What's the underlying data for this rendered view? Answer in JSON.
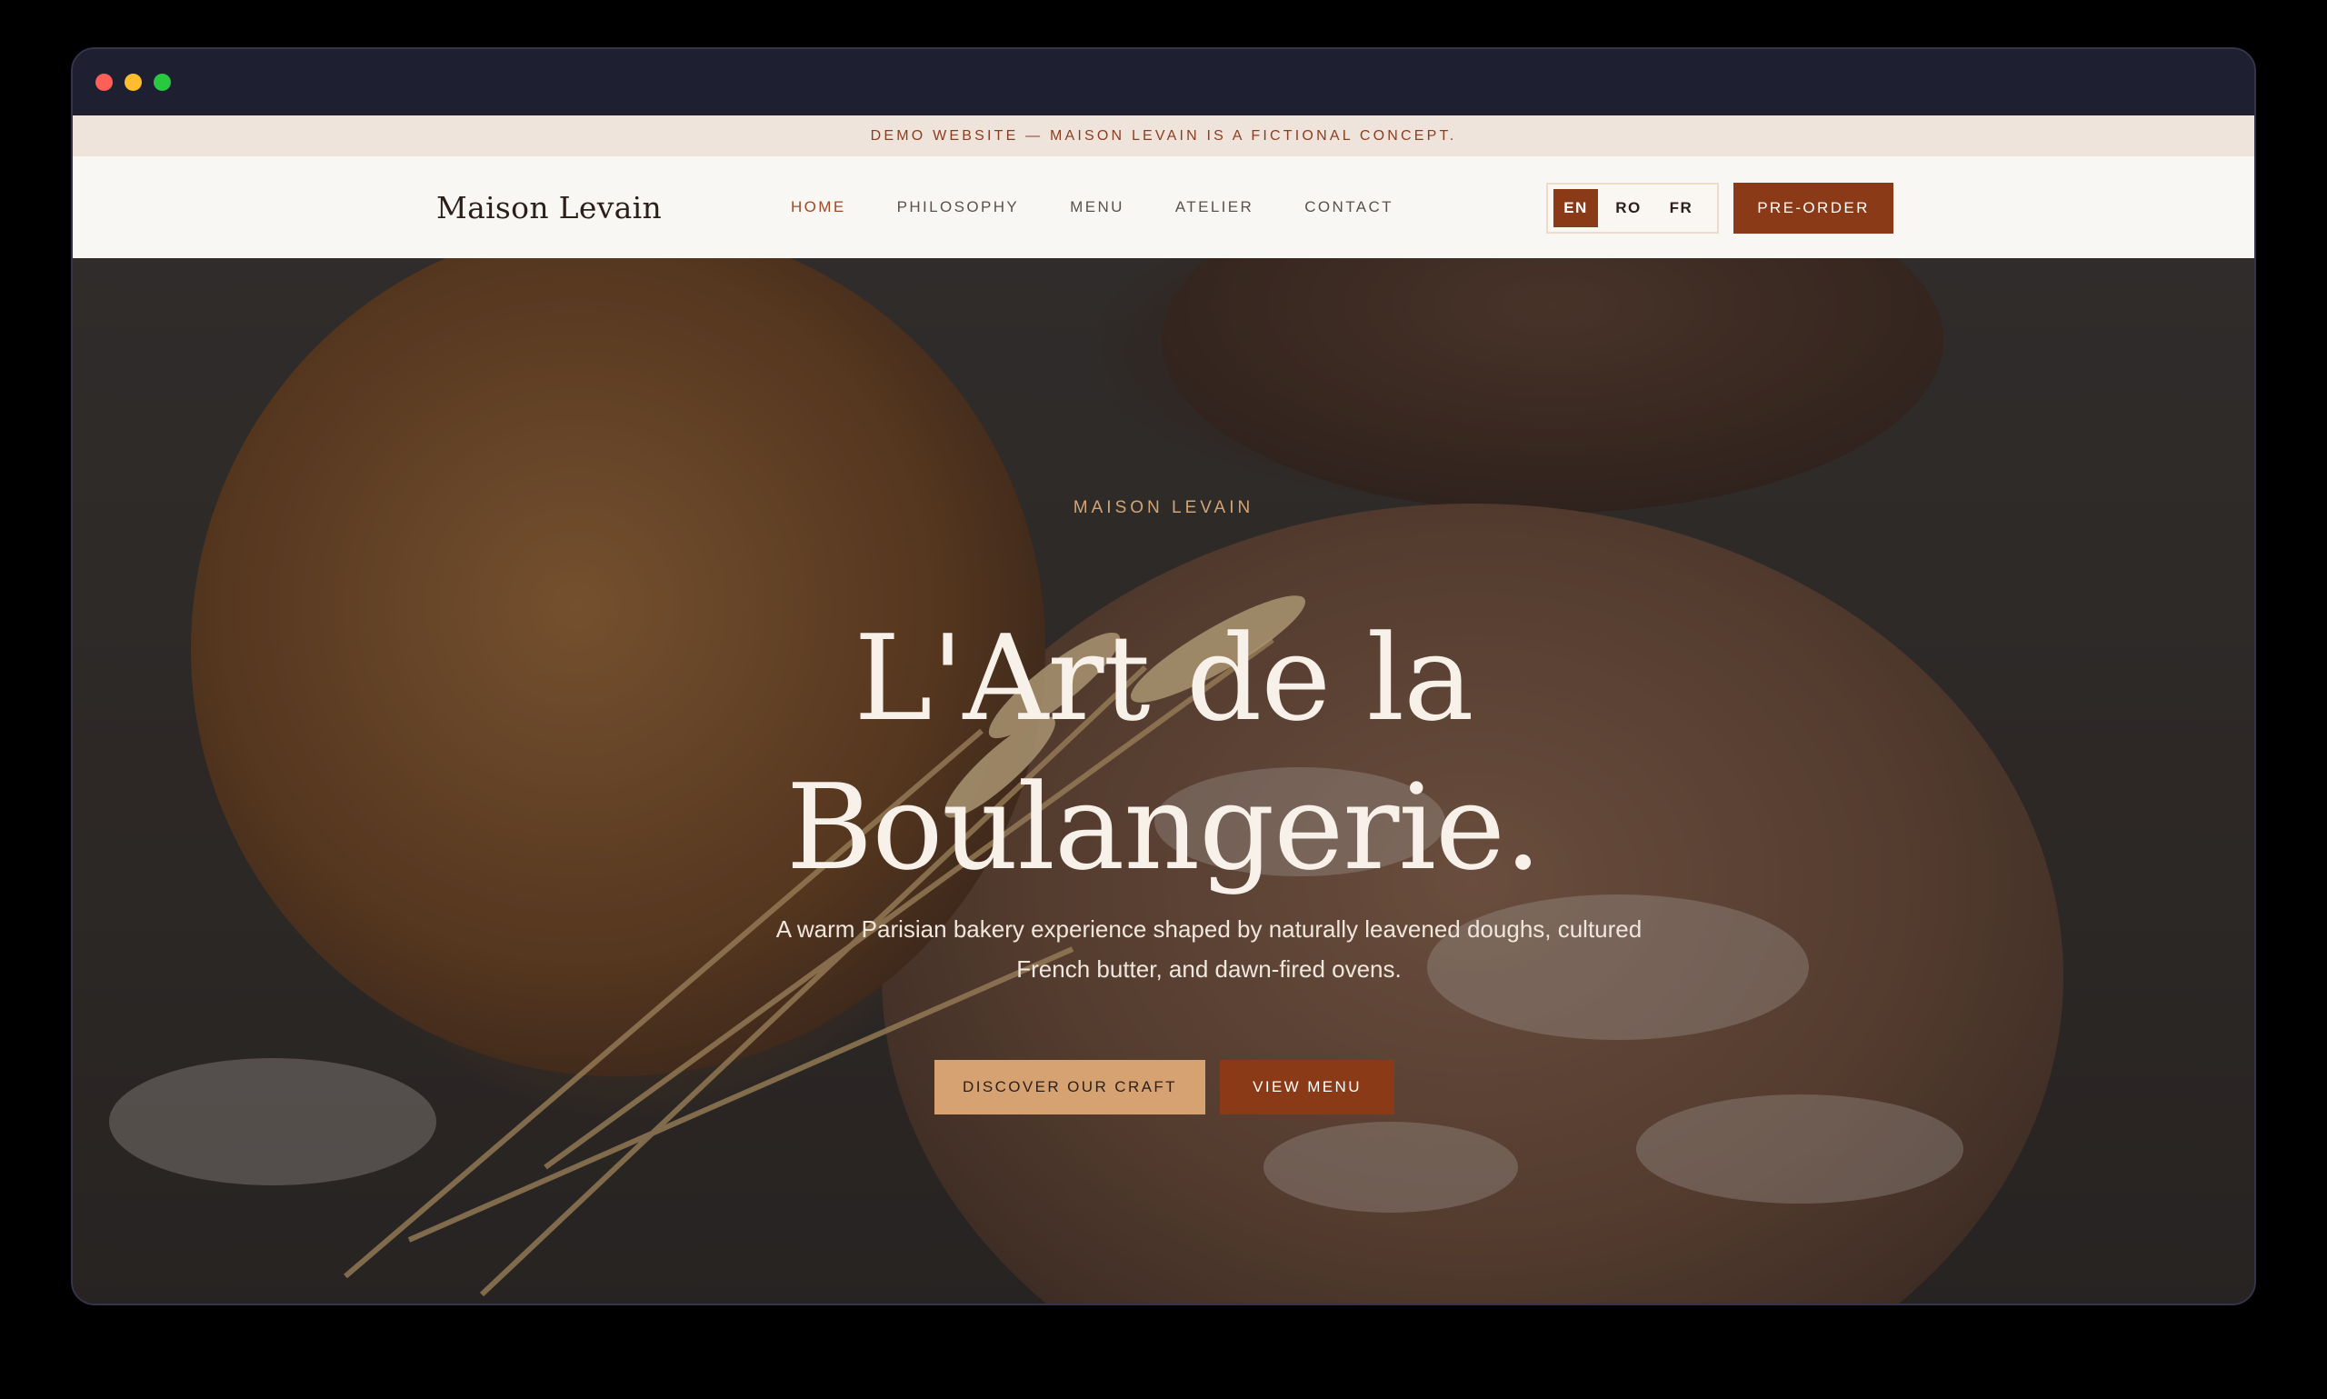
{
  "window": {
    "controls": [
      "close",
      "minimize",
      "maximize"
    ]
  },
  "banner": {
    "text": "DEMO WEBSITE — MAISON LEVAIN IS A FICTIONAL CONCEPT."
  },
  "header": {
    "logo": "Maison Levain",
    "nav": [
      {
        "label": "HOME",
        "active": true
      },
      {
        "label": "PHILOSOPHY",
        "active": false
      },
      {
        "label": "MENU",
        "active": false
      },
      {
        "label": "ATELIER",
        "active": false
      },
      {
        "label": "CONTACT",
        "active": false
      }
    ],
    "languages": [
      {
        "label": "EN",
        "active": true
      },
      {
        "label": "RO",
        "active": false
      },
      {
        "label": "FR",
        "active": false
      }
    ],
    "cta": "PRE-ORDER"
  },
  "hero": {
    "eyebrow": "MAISON LEVAIN",
    "title_line1": "L'Art de la",
    "title_line2": "Boulangerie.",
    "subtitle": "A warm Parisian bakery experience shaped by naturally leavened doughs, cultured French butter, and dawn-fired ovens.",
    "primary_button": "DISCOVER OUR CRAFT",
    "secondary_button": "VIEW MENU",
    "background_image": "rustic breads with wheat stalks on a floured dark table"
  },
  "colors": {
    "accent": "#8b3a18",
    "accent_light": "#d6a272",
    "banner_bg": "#efe4db",
    "nav_bg": "#f9f7f4",
    "titlebar": "#1f1f32"
  }
}
